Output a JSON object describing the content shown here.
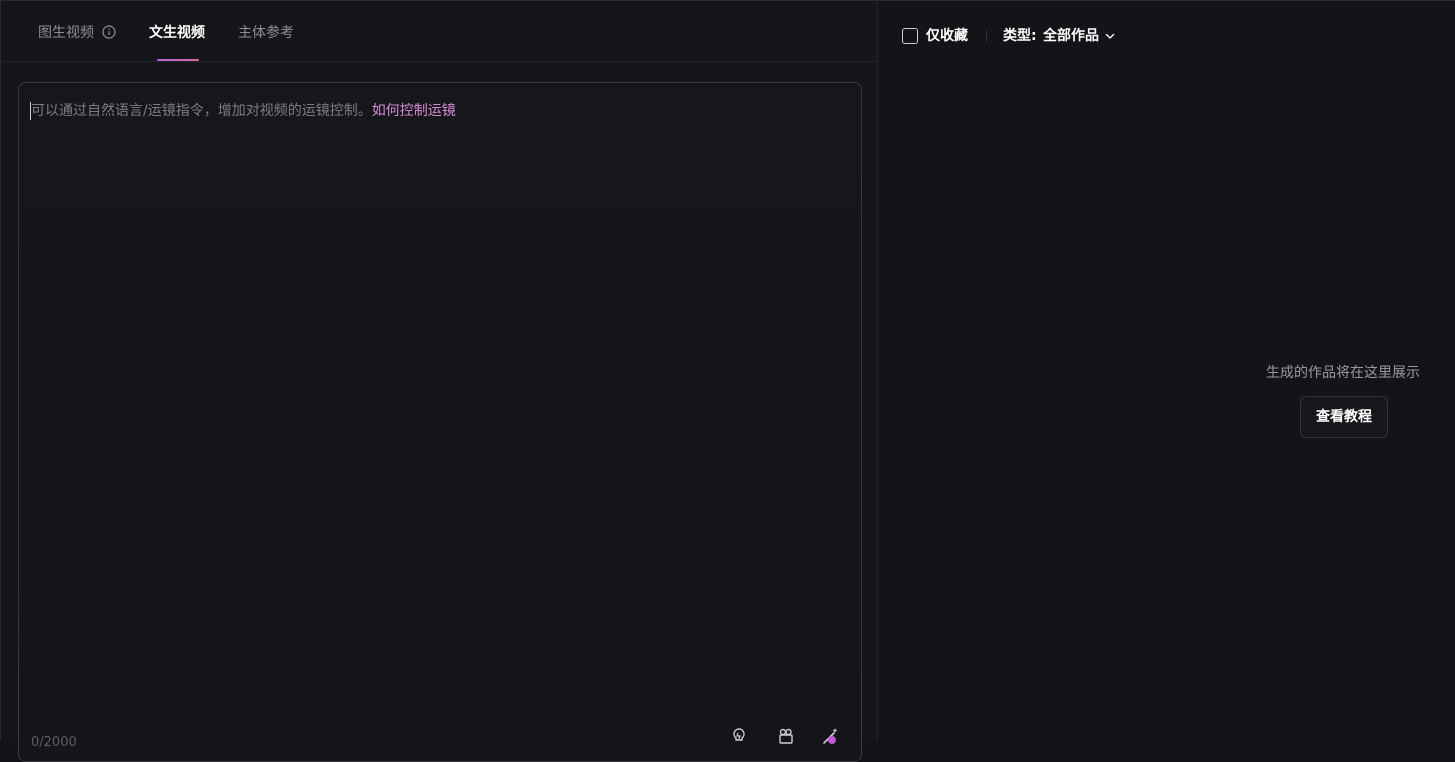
{
  "tabs": {
    "items": [
      {
        "label": "图生视频"
      },
      {
        "label": "文生视频"
      },
      {
        "label": "主体参考"
      }
    ],
    "active_index": 1
  },
  "prompt": {
    "placeholder": "可以通过自然语言/运镜指令，增加对视频的运镜控制。",
    "help_link": "如何控制运镜",
    "char_count": "0/2000"
  },
  "toolbar": {
    "icons": [
      "bulb-icon",
      "camera-icon",
      "magic-wand-icon"
    ]
  },
  "filter": {
    "favorites_label": "仅收藏",
    "favorites_checked": false,
    "type_label": "类型:",
    "type_value": "全部作品"
  },
  "empty_state": {
    "message": "生成的作品将在这里展示",
    "button_label": "查看教程"
  },
  "colors": {
    "accent": "#d98ad9",
    "tab_underline_start": "#b066d6",
    "tab_underline_end": "#e0609e"
  }
}
